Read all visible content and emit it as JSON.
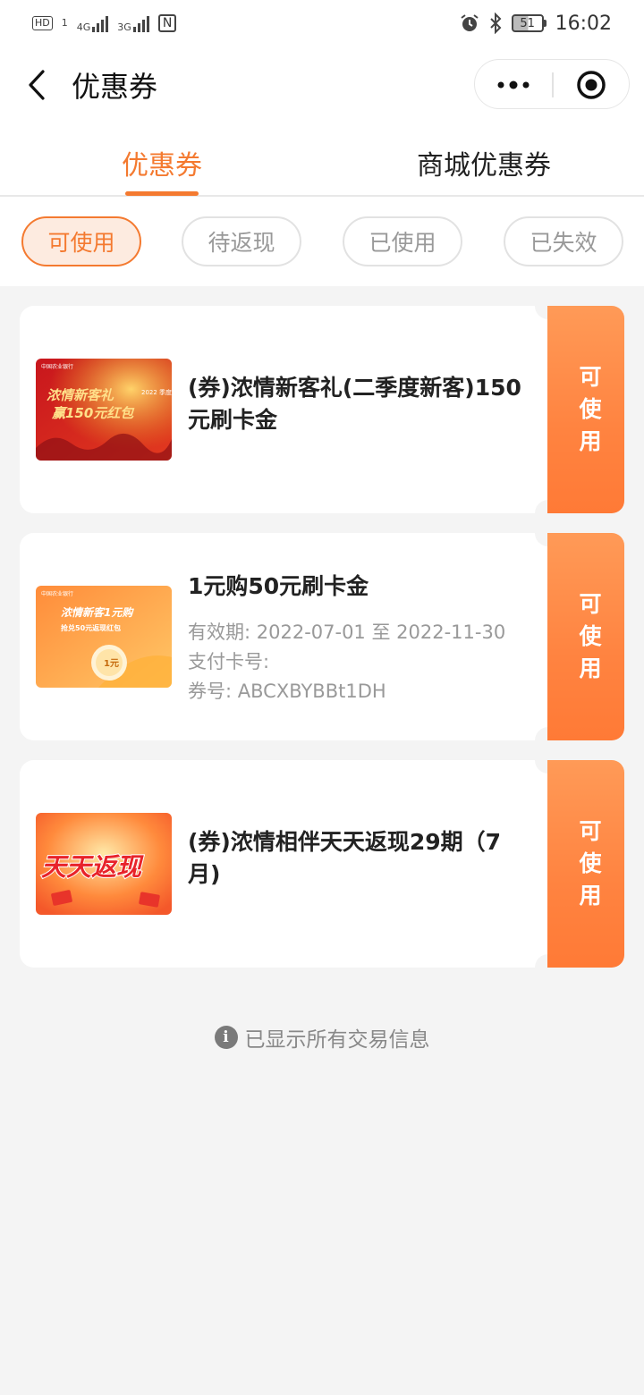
{
  "status_bar": {
    "left_indicators": [
      "HD",
      "1",
      "4G",
      "3G",
      "N"
    ],
    "battery": "51",
    "time": "16:02"
  },
  "nav": {
    "title": "优惠券"
  },
  "main_tabs": {
    "items": [
      {
        "label": "优惠券",
        "active": true
      },
      {
        "label": "商城优惠券",
        "active": false
      }
    ],
    "accent_color": "#f47a30"
  },
  "filters": {
    "items": [
      {
        "label": "可使用",
        "active": true
      },
      {
        "label": "待返现",
        "active": false
      },
      {
        "label": "已使用",
        "active": false
      },
      {
        "label": "已失效",
        "active": false
      }
    ]
  },
  "coupons": [
    {
      "title": "(券)浓情新客礼(二季度新客)150元刷卡金",
      "stub_label": "可使用",
      "thumb_text": [
        "中国农业银行",
        "浓情新客礼",
        "赢150元红包",
        "2022 季度"
      ]
    },
    {
      "title": "1元购50元刷卡金",
      "validity": "有效期: 2022-07-01 至 2022-11-30",
      "card_no": "支付卡号:",
      "coupon_no": "券号: ABCXBYBBt1DH",
      "stub_label": "可使用",
      "thumb_text": [
        "中国农业银行",
        "浓情新客1元购",
        "抢兑50元返现红包",
        "1元"
      ]
    },
    {
      "title": "(券)浓情相伴天天返现29期（7月)",
      "stub_label": "可使用",
      "thumb_text": [
        "天天返现"
      ]
    }
  ],
  "footer": {
    "info_icon": "i",
    "text": "已显示所有交易信息"
  }
}
